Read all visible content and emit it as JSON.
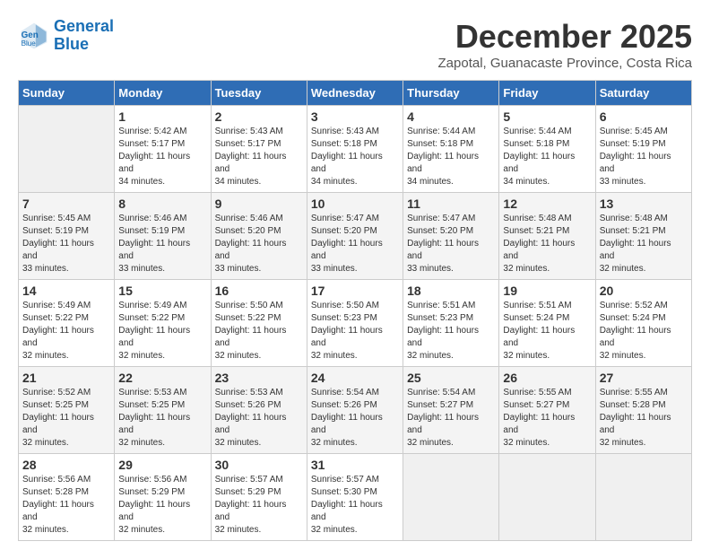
{
  "logo": {
    "line1": "General",
    "line2": "Blue"
  },
  "title": "December 2025",
  "subtitle": "Zapotal, Guanacaste Province, Costa Rica",
  "days_of_week": [
    "Sunday",
    "Monday",
    "Tuesday",
    "Wednesday",
    "Thursday",
    "Friday",
    "Saturday"
  ],
  "weeks": [
    [
      {
        "day": "",
        "sunrise": "",
        "sunset": "",
        "daylight": ""
      },
      {
        "day": "1",
        "sunrise": "Sunrise: 5:42 AM",
        "sunset": "Sunset: 5:17 PM",
        "daylight": "Daylight: 11 hours and 34 minutes."
      },
      {
        "day": "2",
        "sunrise": "Sunrise: 5:43 AM",
        "sunset": "Sunset: 5:17 PM",
        "daylight": "Daylight: 11 hours and 34 minutes."
      },
      {
        "day": "3",
        "sunrise": "Sunrise: 5:43 AM",
        "sunset": "Sunset: 5:18 PM",
        "daylight": "Daylight: 11 hours and 34 minutes."
      },
      {
        "day": "4",
        "sunrise": "Sunrise: 5:44 AM",
        "sunset": "Sunset: 5:18 PM",
        "daylight": "Daylight: 11 hours and 34 minutes."
      },
      {
        "day": "5",
        "sunrise": "Sunrise: 5:44 AM",
        "sunset": "Sunset: 5:18 PM",
        "daylight": "Daylight: 11 hours and 34 minutes."
      },
      {
        "day": "6",
        "sunrise": "Sunrise: 5:45 AM",
        "sunset": "Sunset: 5:19 PM",
        "daylight": "Daylight: 11 hours and 33 minutes."
      }
    ],
    [
      {
        "day": "7",
        "sunrise": "Sunrise: 5:45 AM",
        "sunset": "Sunset: 5:19 PM",
        "daylight": "Daylight: 11 hours and 33 minutes."
      },
      {
        "day": "8",
        "sunrise": "Sunrise: 5:46 AM",
        "sunset": "Sunset: 5:19 PM",
        "daylight": "Daylight: 11 hours and 33 minutes."
      },
      {
        "day": "9",
        "sunrise": "Sunrise: 5:46 AM",
        "sunset": "Sunset: 5:20 PM",
        "daylight": "Daylight: 11 hours and 33 minutes."
      },
      {
        "day": "10",
        "sunrise": "Sunrise: 5:47 AM",
        "sunset": "Sunset: 5:20 PM",
        "daylight": "Daylight: 11 hours and 33 minutes."
      },
      {
        "day": "11",
        "sunrise": "Sunrise: 5:47 AM",
        "sunset": "Sunset: 5:20 PM",
        "daylight": "Daylight: 11 hours and 33 minutes."
      },
      {
        "day": "12",
        "sunrise": "Sunrise: 5:48 AM",
        "sunset": "Sunset: 5:21 PM",
        "daylight": "Daylight: 11 hours and 32 minutes."
      },
      {
        "day": "13",
        "sunrise": "Sunrise: 5:48 AM",
        "sunset": "Sunset: 5:21 PM",
        "daylight": "Daylight: 11 hours and 32 minutes."
      }
    ],
    [
      {
        "day": "14",
        "sunrise": "Sunrise: 5:49 AM",
        "sunset": "Sunset: 5:22 PM",
        "daylight": "Daylight: 11 hours and 32 minutes."
      },
      {
        "day": "15",
        "sunrise": "Sunrise: 5:49 AM",
        "sunset": "Sunset: 5:22 PM",
        "daylight": "Daylight: 11 hours and 32 minutes."
      },
      {
        "day": "16",
        "sunrise": "Sunrise: 5:50 AM",
        "sunset": "Sunset: 5:22 PM",
        "daylight": "Daylight: 11 hours and 32 minutes."
      },
      {
        "day": "17",
        "sunrise": "Sunrise: 5:50 AM",
        "sunset": "Sunset: 5:23 PM",
        "daylight": "Daylight: 11 hours and 32 minutes."
      },
      {
        "day": "18",
        "sunrise": "Sunrise: 5:51 AM",
        "sunset": "Sunset: 5:23 PM",
        "daylight": "Daylight: 11 hours and 32 minutes."
      },
      {
        "day": "19",
        "sunrise": "Sunrise: 5:51 AM",
        "sunset": "Sunset: 5:24 PM",
        "daylight": "Daylight: 11 hours and 32 minutes."
      },
      {
        "day": "20",
        "sunrise": "Sunrise: 5:52 AM",
        "sunset": "Sunset: 5:24 PM",
        "daylight": "Daylight: 11 hours and 32 minutes."
      }
    ],
    [
      {
        "day": "21",
        "sunrise": "Sunrise: 5:52 AM",
        "sunset": "Sunset: 5:25 PM",
        "daylight": "Daylight: 11 hours and 32 minutes."
      },
      {
        "day": "22",
        "sunrise": "Sunrise: 5:53 AM",
        "sunset": "Sunset: 5:25 PM",
        "daylight": "Daylight: 11 hours and 32 minutes."
      },
      {
        "day": "23",
        "sunrise": "Sunrise: 5:53 AM",
        "sunset": "Sunset: 5:26 PM",
        "daylight": "Daylight: 11 hours and 32 minutes."
      },
      {
        "day": "24",
        "sunrise": "Sunrise: 5:54 AM",
        "sunset": "Sunset: 5:26 PM",
        "daylight": "Daylight: 11 hours and 32 minutes."
      },
      {
        "day": "25",
        "sunrise": "Sunrise: 5:54 AM",
        "sunset": "Sunset: 5:27 PM",
        "daylight": "Daylight: 11 hours and 32 minutes."
      },
      {
        "day": "26",
        "sunrise": "Sunrise: 5:55 AM",
        "sunset": "Sunset: 5:27 PM",
        "daylight": "Daylight: 11 hours and 32 minutes."
      },
      {
        "day": "27",
        "sunrise": "Sunrise: 5:55 AM",
        "sunset": "Sunset: 5:28 PM",
        "daylight": "Daylight: 11 hours and 32 minutes."
      }
    ],
    [
      {
        "day": "28",
        "sunrise": "Sunrise: 5:56 AM",
        "sunset": "Sunset: 5:28 PM",
        "daylight": "Daylight: 11 hours and 32 minutes."
      },
      {
        "day": "29",
        "sunrise": "Sunrise: 5:56 AM",
        "sunset": "Sunset: 5:29 PM",
        "daylight": "Daylight: 11 hours and 32 minutes."
      },
      {
        "day": "30",
        "sunrise": "Sunrise: 5:57 AM",
        "sunset": "Sunset: 5:29 PM",
        "daylight": "Daylight: 11 hours and 32 minutes."
      },
      {
        "day": "31",
        "sunrise": "Sunrise: 5:57 AM",
        "sunset": "Sunset: 5:30 PM",
        "daylight": "Daylight: 11 hours and 32 minutes."
      },
      {
        "day": "",
        "sunrise": "",
        "sunset": "",
        "daylight": ""
      },
      {
        "day": "",
        "sunrise": "",
        "sunset": "",
        "daylight": ""
      },
      {
        "day": "",
        "sunrise": "",
        "sunset": "",
        "daylight": ""
      }
    ]
  ]
}
